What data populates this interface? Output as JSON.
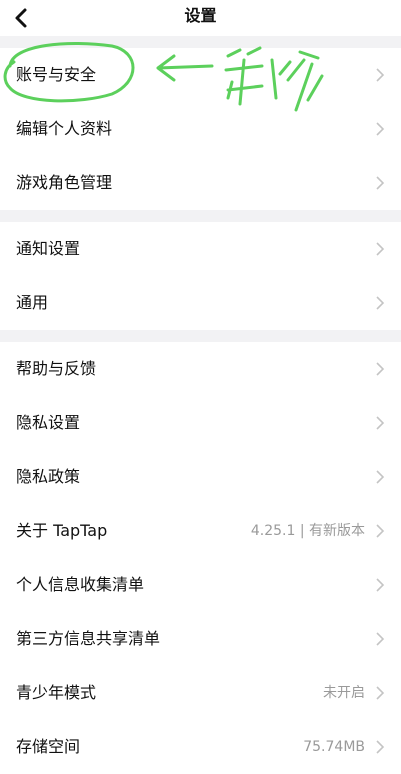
{
  "header": {
    "title": "设置",
    "back_icon": "back-arrow-icon"
  },
  "settings": {
    "chevron_icon": "chevron-right-icon",
    "items": [
      {
        "label": "账号与安全",
        "value": ""
      },
      {
        "label": "编辑个人资料",
        "value": ""
      },
      {
        "label": "游戏角色管理",
        "value": ""
      },
      {
        "label": "通知设置",
        "value": ""
      },
      {
        "label": "通用",
        "value": ""
      },
      {
        "label": "帮助与反馈",
        "value": ""
      },
      {
        "label": "隐私设置",
        "value": ""
      },
      {
        "label": "隐私政策",
        "value": ""
      },
      {
        "label": "关于 TapTap",
        "value": "4.25.1 | 有新版本"
      },
      {
        "label": "个人信息收集清单",
        "value": ""
      },
      {
        "label": "第三方信息共享清单",
        "value": ""
      },
      {
        "label": "青少年模式",
        "value": "未开启"
      },
      {
        "label": "存储空间",
        "value": "75.74MB"
      }
    ]
  },
  "annotation": {
    "handwritten_text": "第1步",
    "color": "#5cd05c"
  },
  "colors": {
    "section_gap": "#f2f2f4",
    "value_text": "#9a9a9a",
    "chevron": "#c4c4c4"
  }
}
